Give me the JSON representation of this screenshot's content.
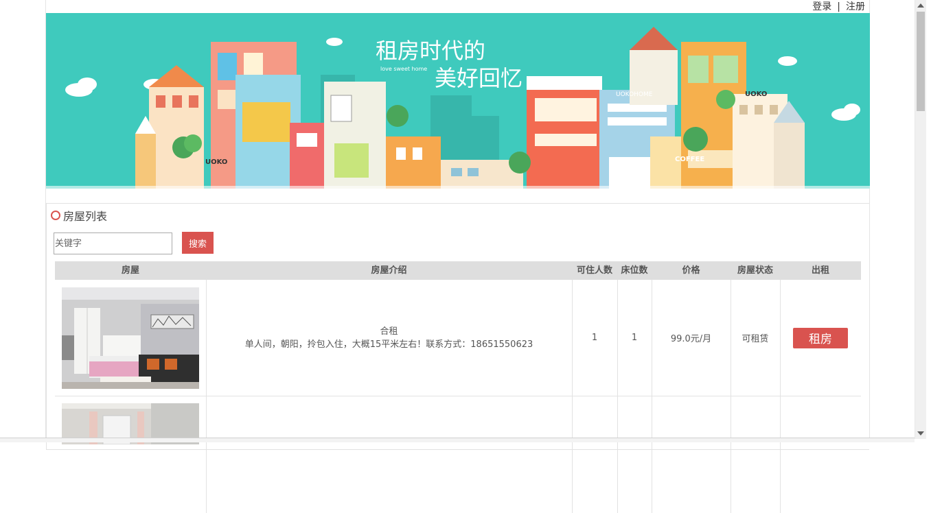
{
  "auth": {
    "login": "登录",
    "separator": "|",
    "register": "注册"
  },
  "banner": {
    "title_line1": "租房时代的",
    "title_line2": "美好回忆",
    "subtitle": "love sweet home",
    "signs": [
      "UOKO",
      "UOKOHOME",
      "COFFEE",
      "UOKO"
    ],
    "colors": {
      "background": "#3fcabd"
    }
  },
  "panel": {
    "title": "房屋列表"
  },
  "search": {
    "placeholder": "关键字",
    "button": "搜索"
  },
  "table": {
    "headers": [
      "房屋",
      "房屋介绍",
      "可住人数",
      "床位数",
      "价格",
      "房屋状态",
      "出租"
    ],
    "rows": [
      {
        "intro_title": "合租",
        "intro_desc": "单人间，朝阳，拎包入住，大概15平米左右！联系方式：18651550623",
        "capacity": "1",
        "beds": "1",
        "price": "99.0元/月",
        "status": "可租赁",
        "action": "租房"
      },
      {
        "intro_title": "",
        "intro_desc": "",
        "capacity": "",
        "beds": "",
        "price": "",
        "status": "",
        "action": ""
      }
    ]
  },
  "colors": {
    "accent": "#d9534f",
    "header_bg": "#dedede"
  }
}
